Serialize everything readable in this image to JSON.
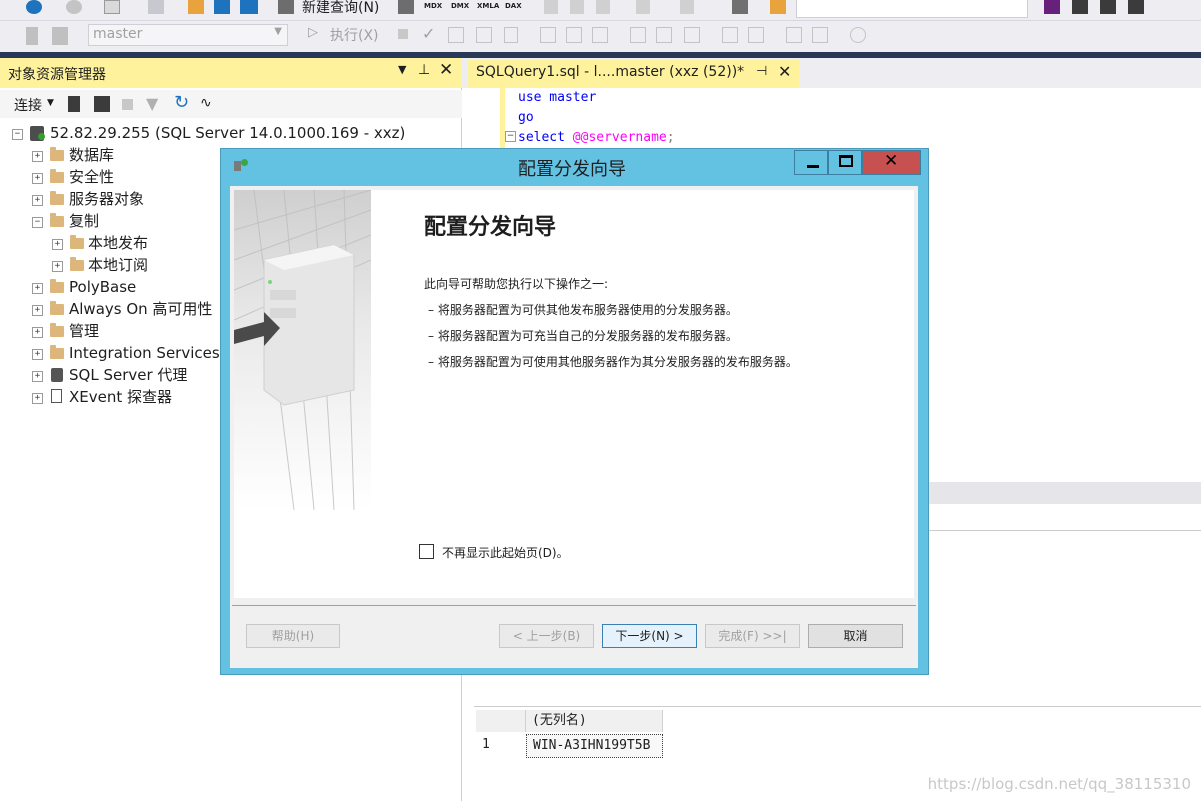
{
  "toolbar": {
    "new_query": "新建查询(N)",
    "mdx": "MDX",
    "dmx": "DMX",
    "xmla": "XMLA",
    "dax": "DAX",
    "database": "master",
    "execute": "执行(X)"
  },
  "object_explorer": {
    "title": "对象资源管理器",
    "connect": "连接",
    "server": "52.82.29.255 (SQL Server 14.0.1000.169 - xxz)",
    "nodes": {
      "databases": "数据库",
      "security": "安全性",
      "server_objects": "服务器对象",
      "replication": "复制",
      "local_publications": "本地发布",
      "local_subscriptions": "本地订阅",
      "polybase": "PolyBase",
      "always_on": "Always On 高可用性",
      "management": "管理",
      "integration_services": "Integration Services",
      "sql_agent": "SQL Server 代理",
      "xevent": "XEvent 探查器"
    }
  },
  "editor": {
    "tab_title": "SQLQuery1.sql - l....master (xxz (52))*",
    "line1": "use master",
    "line2": "go",
    "line3_kw": "select ",
    "line3_fn": "@@servername",
    "line3_end": ";"
  },
  "results": {
    "column": "(无列名)",
    "row_num": "1",
    "value": "WIN-A3IHN199T5B"
  },
  "dialog": {
    "window_title": "配置分发向导",
    "heading": "配置分发向导",
    "intro": "此向导可帮助您执行以下操作之一:",
    "bullets": [
      "–  将服务器配置为可供其他发布服务器使用的分发服务器。",
      "–  将服务器配置为可充当自己的分发服务器的发布服务器。",
      "–  将服务器配置为可使用其他服务器作为其分发服务器的发布服务器。"
    ],
    "checkbox_label": "不再显示此起始页(D)。",
    "help": "帮助(H)",
    "back": "< 上一步(B)",
    "next": "下一步(N) >",
    "finish": "完成(F) >>|",
    "cancel": "取消"
  },
  "watermark": "https://blog.csdn.net/qq_38115310",
  "colors": {
    "active_title": "#fff29d",
    "navy": "#293955",
    "dialog_frame": "#63c1e1",
    "close_button": "#c75050",
    "keyword": "#0000ff",
    "system_function": "#ff00ff"
  }
}
